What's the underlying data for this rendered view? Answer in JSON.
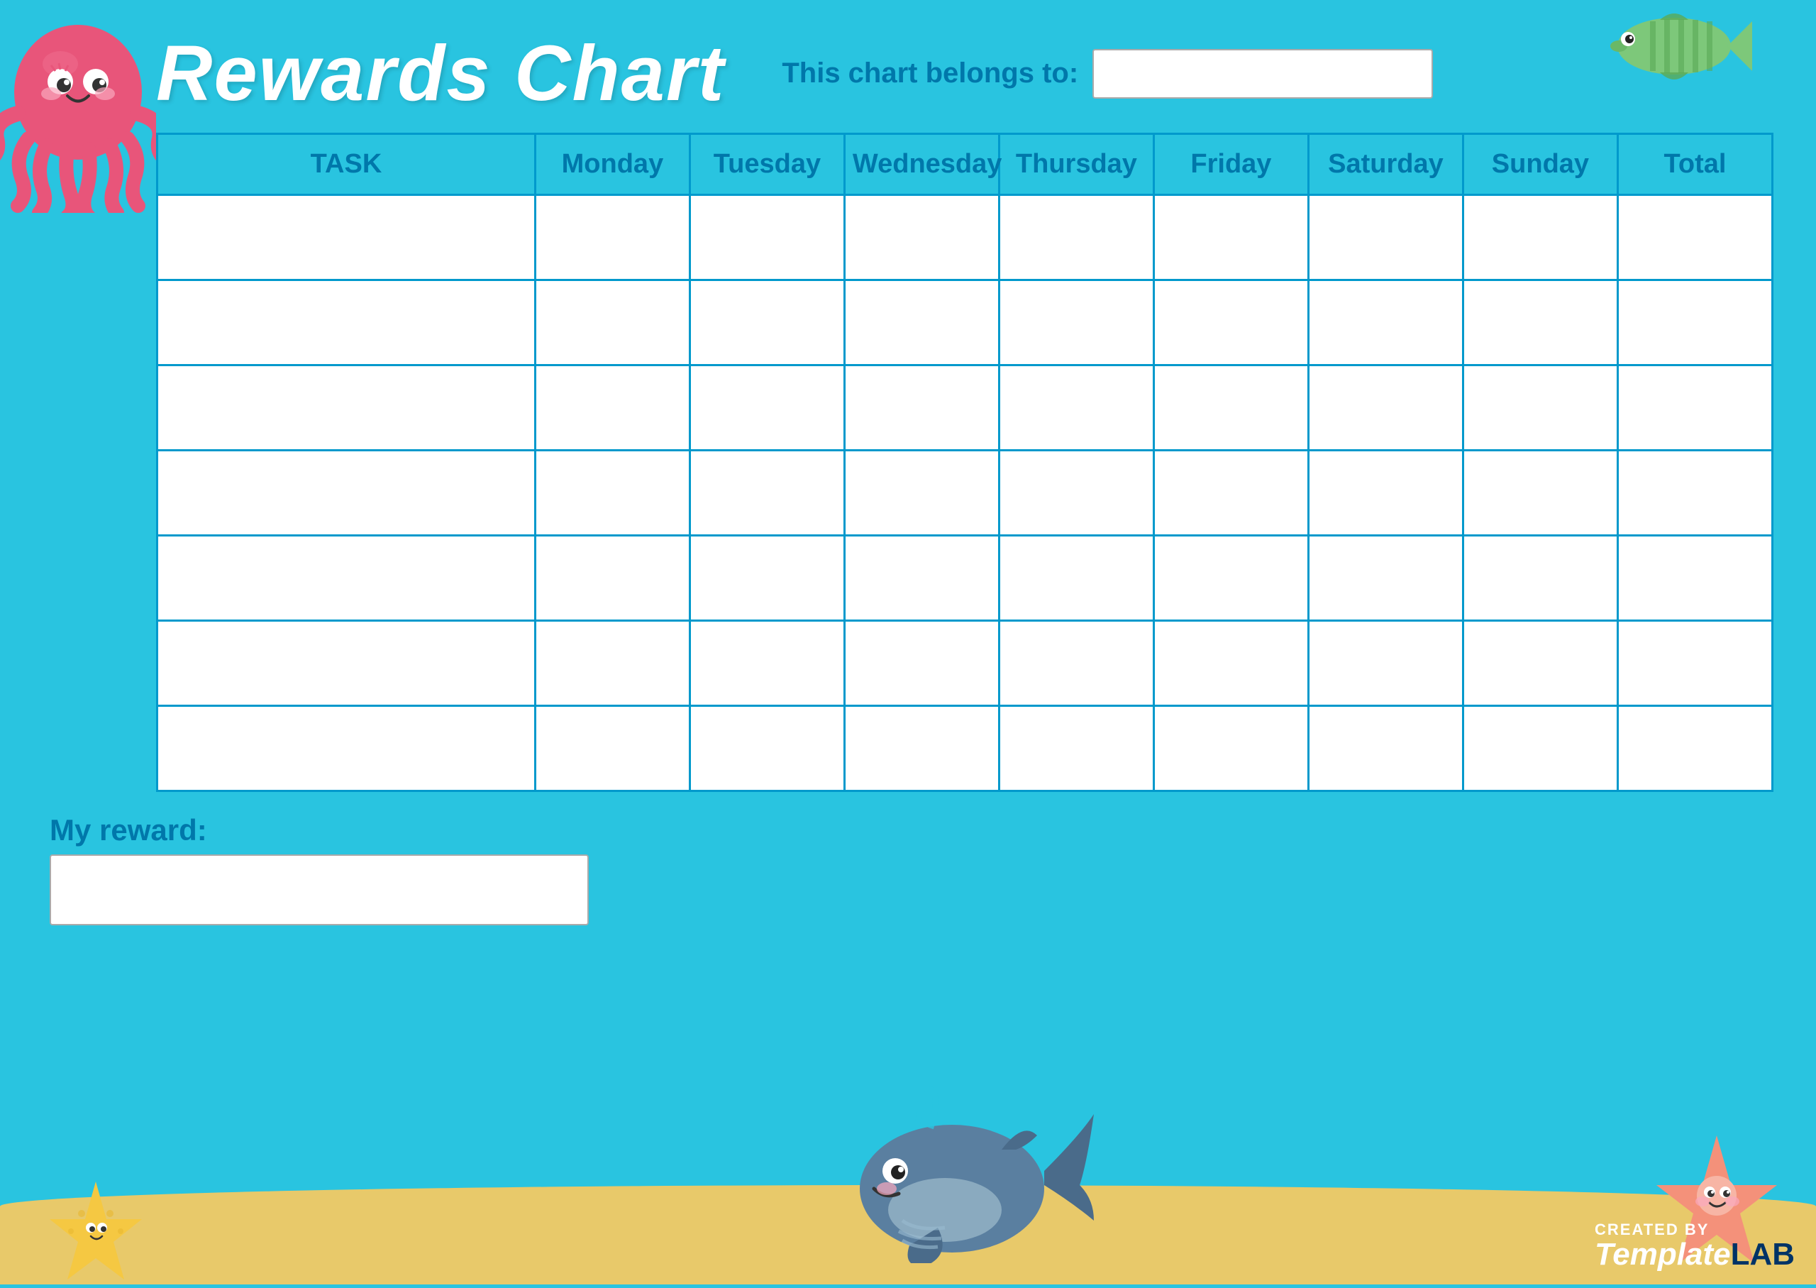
{
  "header": {
    "title": "Rewards Chart",
    "belongs_to_label": "This chart belongs to:",
    "name_placeholder": ""
  },
  "table": {
    "columns": [
      {
        "label": "TASK",
        "type": "task"
      },
      {
        "label": "Monday",
        "type": "day"
      },
      {
        "label": "Tuesday",
        "type": "day"
      },
      {
        "label": "Wednesday",
        "type": "day"
      },
      {
        "label": "Thursday",
        "type": "day"
      },
      {
        "label": "Friday",
        "type": "day"
      },
      {
        "label": "Saturday",
        "type": "day"
      },
      {
        "label": "Sunday",
        "type": "day"
      },
      {
        "label": "Total",
        "type": "total"
      }
    ],
    "row_count": 7
  },
  "bottom": {
    "reward_label": "My reward:",
    "reward_placeholder": ""
  },
  "watermark": {
    "prefix": "Template",
    "suffix": "LAB",
    "created_by": "CREATED BY"
  },
  "icons": {
    "octopus": "octopus-decoration",
    "fish": "fish-decoration",
    "whale": "whale-decoration",
    "starfish_right": "starfish-right-decoration",
    "starfish_left": "starfish-left-decoration"
  }
}
